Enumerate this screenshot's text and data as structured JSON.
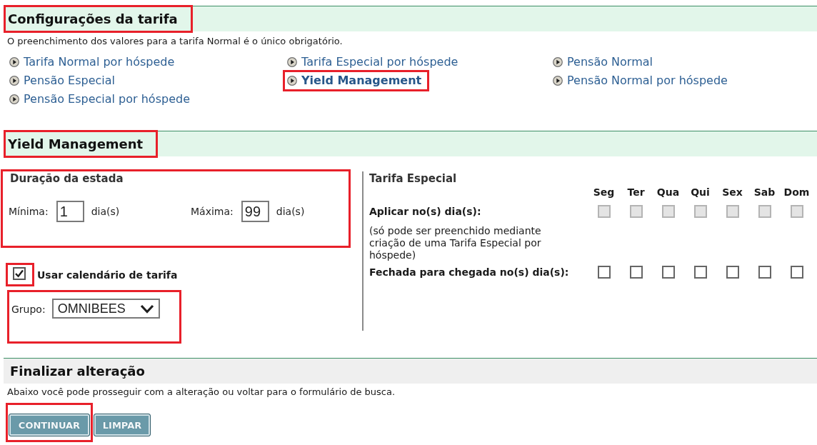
{
  "rate_settings": {
    "title": "Configurações da tarifa",
    "highlighted": true,
    "note": "O preenchimento dos valores para a tarifa Normal é o único obrigatório.",
    "links": [
      {
        "label": "Tarifa Normal por hóspede",
        "selected": false,
        "highlighted": false
      },
      {
        "label": "Tarifa Especial por hóspede",
        "selected": false,
        "highlighted": false
      },
      {
        "label": "Pensão Normal",
        "selected": false,
        "highlighted": false
      },
      {
        "label": "Pensão Especial",
        "selected": false,
        "highlighted": false
      },
      {
        "label": "Yield Management",
        "selected": true,
        "highlighted": true
      },
      {
        "label": "Pensão Normal por hóspede",
        "selected": false,
        "highlighted": false
      },
      {
        "label": "Pensão Especial por hóspede",
        "selected": false,
        "highlighted": false
      }
    ]
  },
  "yield_management": {
    "title": "Yield Management",
    "highlighted": true,
    "stay_duration": {
      "title": "Duração da estada",
      "highlighted": true,
      "minimum": {
        "label": "Mínima:",
        "value": "1",
        "unit": "dia(s)"
      },
      "maximum": {
        "label": "Máxima:",
        "value": "99",
        "unit": "dia(s)"
      }
    },
    "rate_calendar": {
      "label": "Usar calendário de tarifa",
      "checked": true,
      "highlighted": true
    },
    "group": {
      "label": "Grupo:",
      "value": "OMNIBEES",
      "highlighted": true
    },
    "special_rate": {
      "title": "Tarifa Especial",
      "days": [
        "Seg",
        "Ter",
        "Qua",
        "Qui",
        "Sex",
        "Sab",
        "Dom"
      ],
      "rows": [
        {
          "label": "Aplicar no(s) dia(s):",
          "note": "(só pode ser preenchido mediante criação de uma Tarifa Especial por hóspede)",
          "checks": [
            {
              "checked": false,
              "disabled": true
            },
            {
              "checked": false,
              "disabled": true
            },
            {
              "checked": false,
              "disabled": true
            },
            {
              "checked": false,
              "disabled": true
            },
            {
              "checked": false,
              "disabled": true
            },
            {
              "checked": false,
              "disabled": true
            },
            {
              "checked": false,
              "disabled": true
            }
          ]
        },
        {
          "label": "Fechada para chegada no(s) dia(s):",
          "checks": [
            {
              "checked": false,
              "disabled": false
            },
            {
              "checked": false,
              "disabled": false
            },
            {
              "checked": false,
              "disabled": false
            },
            {
              "checked": false,
              "disabled": false
            },
            {
              "checked": false,
              "disabled": false
            },
            {
              "checked": false,
              "disabled": false
            },
            {
              "checked": false,
              "disabled": false
            }
          ]
        }
      ]
    }
  },
  "finish": {
    "title": "Finalizar alteração",
    "note": "Abaixo você pode prosseguir com a alteração ou voltar para o formulário de busca.",
    "buttons": [
      {
        "label": "CONTINUAR",
        "highlighted": true
      },
      {
        "label": "LIMPAR",
        "highlighted": false
      }
    ]
  }
}
